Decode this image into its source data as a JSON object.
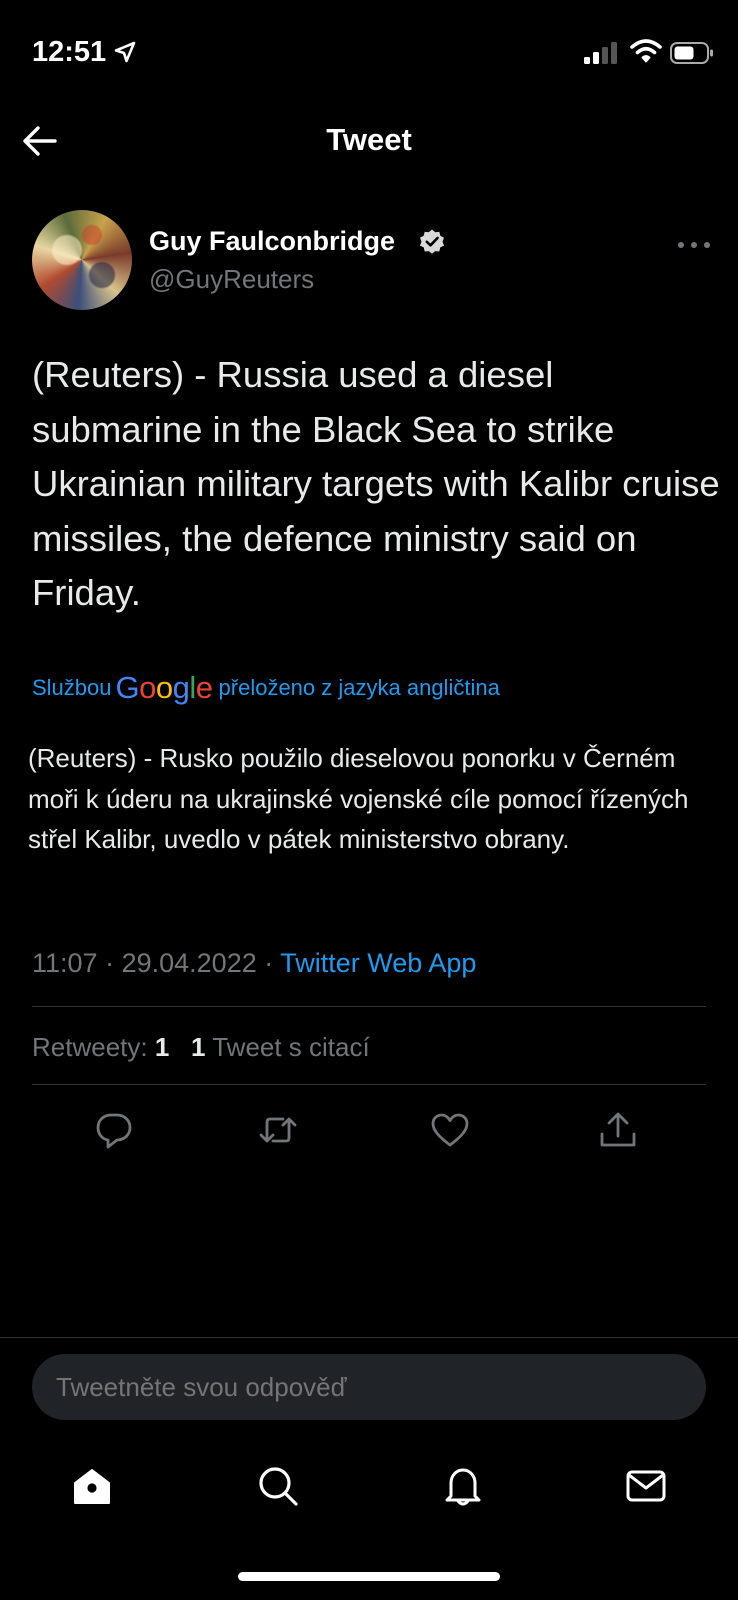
{
  "status": {
    "time": "12:51"
  },
  "header": {
    "title": "Tweet"
  },
  "author": {
    "name": "Guy Faulconbridge",
    "handle": "@GuyReuters"
  },
  "tweet": {
    "text": "(Reuters) - Russia used a diesel submarine in the Black Sea to strike Ukrainian military targets with Kalibr cruise missiles, the defence ministry said on Friday.",
    "translation_prefix": "Službou",
    "translation_brand": "Google",
    "translation_suffix": "přeloženo z jazyka angličtina",
    "translated_text": "(Reuters) - Rusko použilo dieselovou ponorku v Černém moři k úderu na ukrajinské vojenské cíle pomocí řízených střel Kalibr, uvedlo v pátek ministerstvo obrany.",
    "time": "11:07",
    "date": "29.04.2022",
    "source": "Twitter Web App",
    "separator": "·"
  },
  "stats": {
    "retweets_label": "Retweety:",
    "retweets_count": "1",
    "quotes_count": "1",
    "quotes_label": "Tweet s citací"
  },
  "actions": [
    "reply-icon",
    "retweet-icon",
    "like-icon",
    "share-icon"
  ],
  "reply_box": {
    "placeholder": "Tweetněte svou odpověď"
  },
  "bottom_nav": [
    "home-icon",
    "search-icon",
    "notifications-icon",
    "messages-icon"
  ],
  "colors": {
    "background": "#000000",
    "accent": "#1d9bf0",
    "muted": "#71767b",
    "text": "#e7e9ea"
  }
}
